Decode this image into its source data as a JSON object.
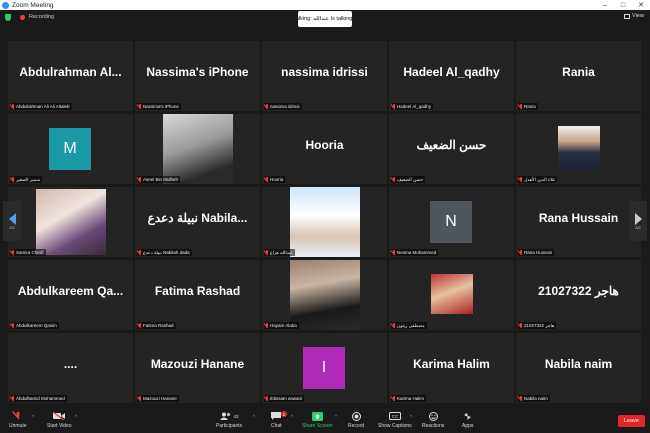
{
  "window": {
    "title": "Zoom Meeting"
  },
  "top": {
    "recording_label": "Recording",
    "talking": "Talking: عبدالله Is talking...",
    "view_label": "View"
  },
  "tiles": [
    {
      "big": "Abdulrahman  Al...",
      "name": "Abdulrahman Ali Ali Altaleb"
    },
    {
      "big": "Nassima's iPhone",
      "name": "Nassima's iPhone"
    },
    {
      "big": "nassima idrissi",
      "name": "nassima idrissi"
    },
    {
      "big": "Hadeel Al_qadhy",
      "name": "Hadeel Al_qadhy"
    },
    {
      "big": "Rania",
      "name": "Rania"
    },
    {
      "big": "",
      "name": "سمير الصغير",
      "letter": "M"
    },
    {
      "big": "",
      "name": "Aseel Bin Mulheh"
    },
    {
      "big": "Hooria",
      "name": "Hooria"
    },
    {
      "big": "حسن الضعيف",
      "name": "حسن الضعيف"
    },
    {
      "big": "",
      "name": "علاء الدين الأهدل"
    },
    {
      "big": "",
      "name": "Samira Cherif"
    },
    {
      "big": "نبيلة دعدع Nabila...",
      "name": "نبيلة دعدع Nabilah dada"
    },
    {
      "big": "",
      "name": "عبدالله هزاع"
    },
    {
      "big": "",
      "name": "Nesma Mohammed",
      "letter": "N"
    },
    {
      "big": "Rana Hussain",
      "name": "Rana Hussain"
    },
    {
      "big": "Abdulkareem  Qa...",
      "name": "Abdulkareem Qasim"
    },
    {
      "big": "Fatima Rashad",
      "name": "Fatima Rashad"
    },
    {
      "big": "",
      "name": "Hayam Alaba"
    },
    {
      "big": "",
      "name": "مصطفى زيتون"
    },
    {
      "big": "هاجر 21027322",
      "name": "هاجر 21027322"
    },
    {
      "big": "....",
      "name": "Abdulhamid Mohammed"
    },
    {
      "big": "Mazouzi Hanane",
      "name": "Mazouzi Hanane"
    },
    {
      "big": "",
      "name": "Ibtissam aswani",
      "letter": "I"
    },
    {
      "big": "Karima Halim",
      "name": "Karima Halim"
    },
    {
      "big": "Nabila naim",
      "name": "Nabila naim"
    }
  ],
  "nav": {
    "left_page": "2/2",
    "right_page": "2/2"
  },
  "toolbar": {
    "unmute": "Unmute",
    "video": "Start Video",
    "participants": "Participants",
    "participant_count": "43",
    "chat": "Chat",
    "chat_badge": "2",
    "share": "Share Screen",
    "record": "Record",
    "captions": "Show Captions",
    "reactions": "Reactions",
    "apps": "Apps",
    "leave": "Leave"
  },
  "colors": {
    "accent": "#2d8cff",
    "share_green": "#2ecc71",
    "leave_red": "#e02828",
    "tile_bg": "#242424",
    "letter_M": "#1a9aa6",
    "letter_N": "#4f565e",
    "letter_I": "#b02ab8"
  }
}
